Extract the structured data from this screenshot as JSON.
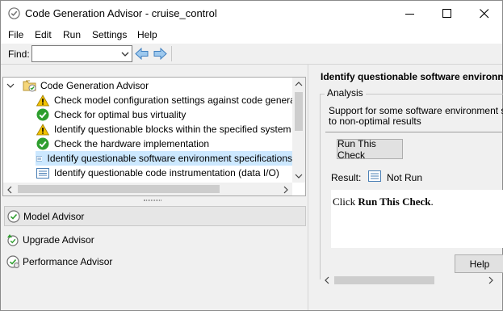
{
  "window": {
    "title": "Code Generation Advisor - cruise_control",
    "icon": "check-circle-icon",
    "controls": [
      "minimize-icon",
      "maximize-icon",
      "close-icon"
    ]
  },
  "menu": [
    "File",
    "Edit",
    "Run",
    "Settings",
    "Help"
  ],
  "toolbar": {
    "find_label": "Find:",
    "find_value": "",
    "icons": [
      "arrow-left-icon",
      "arrow-right-icon"
    ]
  },
  "tree": {
    "root": {
      "label": "Code Generation Advisor",
      "icon": "folder-check-icon"
    },
    "items": [
      {
        "label": "Check model configuration settings against code generation",
        "status": "warning"
      },
      {
        "label": "Check for optimal bus virtuality",
        "status": "passed"
      },
      {
        "label": "Identify questionable blocks within the specified system",
        "status": "warning"
      },
      {
        "label": "Check the hardware implementation",
        "status": "passed"
      },
      {
        "label": "Identify questionable software environment specifications",
        "status": "not-run",
        "selected": true
      },
      {
        "label": "Identify questionable code instrumentation (data I/O)",
        "status": "not-run"
      }
    ]
  },
  "advisors": [
    {
      "label": "Model Advisor",
      "icon": "model-advisor-icon",
      "active": true
    },
    {
      "label": "Upgrade Advisor",
      "icon": "upgrade-advisor-icon"
    },
    {
      "label": "Performance Advisor",
      "icon": "performance-advisor-icon"
    }
  ],
  "detail": {
    "heading": "Identify questionable software environme",
    "analysis_label": "Analysis",
    "description_line1": "Support for some software environment se",
    "description_line2": "to non-optimal results",
    "run_button": "Run This Check",
    "result_label": "Result:",
    "result_value": "Not Run",
    "report_prefix": "Click ",
    "report_bold": "Run This Check",
    "report_suffix": ".",
    "help_button": "Help"
  },
  "colors": {
    "selection": "#cce8ff",
    "passed": "#2e9e2e",
    "warning": "#f2c200"
  }
}
